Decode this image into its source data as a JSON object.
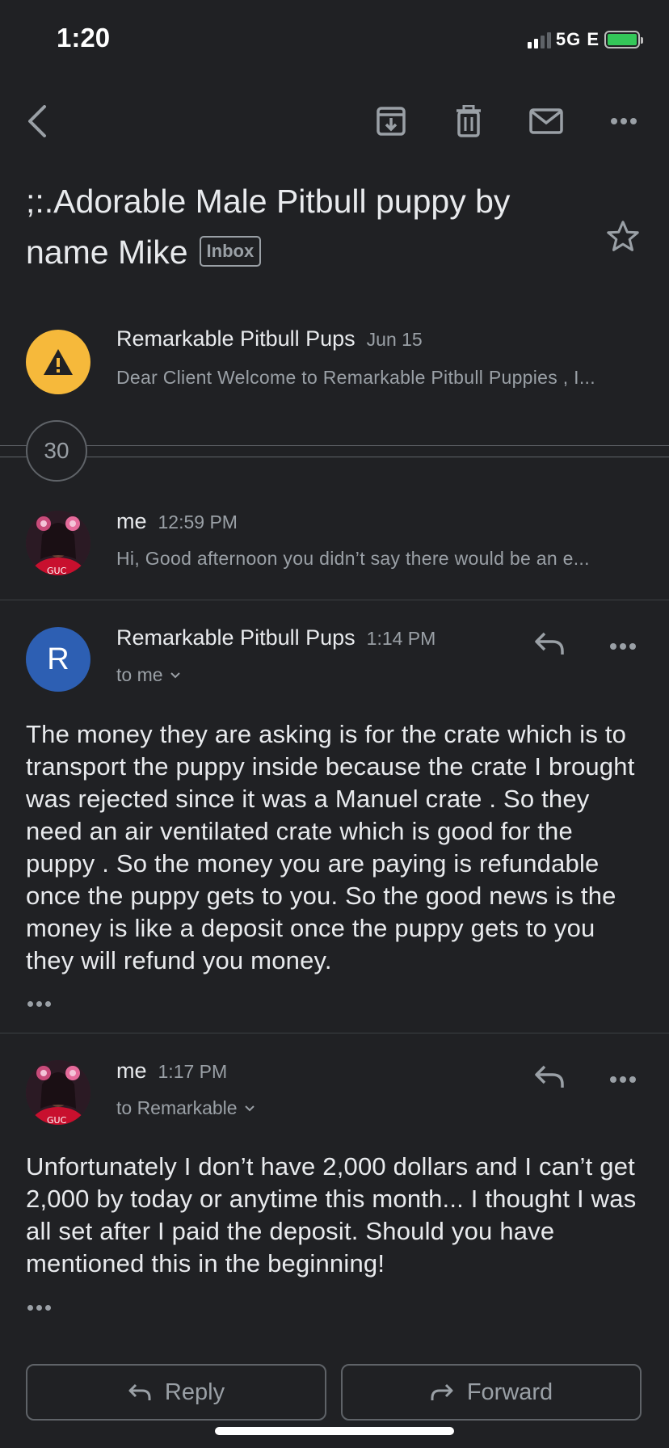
{
  "status_bar": {
    "time": "1:20",
    "network": "5G E"
  },
  "toolbar": {
    "back_icon": "chevron-left-icon",
    "archive_icon": "archive-icon",
    "delete_icon": "trash-icon",
    "mark_unread_icon": "mail-icon",
    "more_icon": "more-horizontal-icon"
  },
  "subject": {
    "title": ";:.Adorable Male Pitbull puppy by name Mike",
    "label": "Inbox",
    "starred": false
  },
  "messages": [
    {
      "sender": "Remarkable Pitbull Pups",
      "time": "Jun 15",
      "snippet": "Dear Client Welcome to Remarkable Pitbull Puppies , I...",
      "avatar": "warning-icon",
      "avatar_color": "#f6b93b"
    },
    {
      "sender": "me",
      "time": "12:59 PM",
      "snippet": "Hi, Good afternoon you didn’t say there would be an e..."
    },
    {
      "sender": "Remarkable Pitbull Pups",
      "time": "1:14 PM",
      "to": "to me",
      "avatar_letter": "R",
      "avatar_color": "#2d5fb3",
      "body": "The money they are asking is for the crate which is to transport the puppy inside because the crate I brought was rejected since it was a Manuel crate . So they need an air ventilated crate which is good for the puppy . So the money you are paying is refundable once the puppy gets to you. So the good news is the money is like a deposit once the puppy gets to you they will refund you money."
    },
    {
      "sender": "me",
      "time": "1:17 PM",
      "to": "to Remarkable",
      "body": "Unfortunately I don’t have 2,000 dollars and I can’t get 2,000 by today or anytime this month...  I thought I was all set after I paid the deposit. Should you have mentioned this in the beginning!"
    }
  ],
  "collapsed_count": "30",
  "actions": {
    "reply_label": "Reply",
    "forward_label": "Forward"
  }
}
